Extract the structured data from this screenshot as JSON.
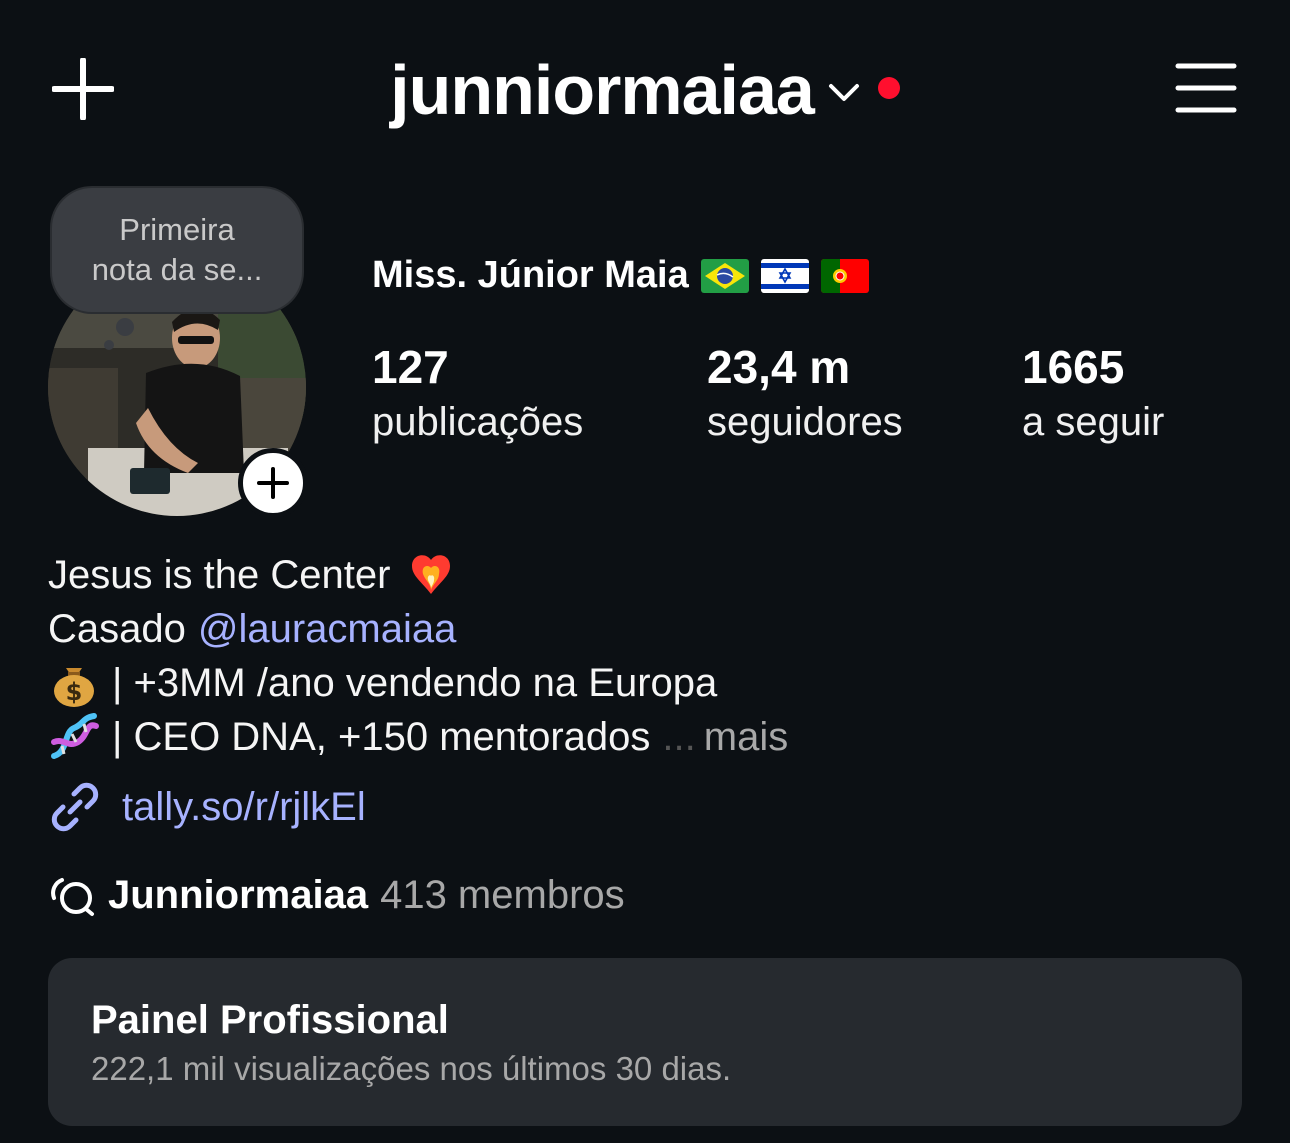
{
  "header": {
    "username": "junniormaiaa",
    "notification_dot_color": "#ff0f2e"
  },
  "note": {
    "line1": "Primeira",
    "line2": "nota da se..."
  },
  "profile": {
    "full_name": "Miss. Júnior Maia",
    "flags": [
      "brazil-flag",
      "israel-flag",
      "portugal-flag"
    ]
  },
  "stats": [
    {
      "value": "127",
      "label": "publicações"
    },
    {
      "value": "23,4 m",
      "label": "seguidores"
    },
    {
      "value": "1665",
      "label": "a seguir"
    }
  ],
  "bio": {
    "line1": "Jesus is the Center",
    "line2_prefix": "Casado",
    "line2_mention": "@lauracmaiaa",
    "line3": "| +3MM /ano vendendo na Europa",
    "line4": "| CEO DNA, +150 mentorados",
    "ellipsis": "...",
    "more": "mais"
  },
  "link": {
    "text": "tally.so/r/rjlkEl"
  },
  "channel": {
    "name": "Junniormaiaa",
    "count": "413 membros"
  },
  "panel": {
    "title": "Painel Profissional",
    "subtitle": "222,1 mil visualizações nos últimos 30 dias."
  },
  "colors": {
    "background": "#0c1014",
    "link": "#a7b2ff",
    "panel": "#262a2f"
  }
}
